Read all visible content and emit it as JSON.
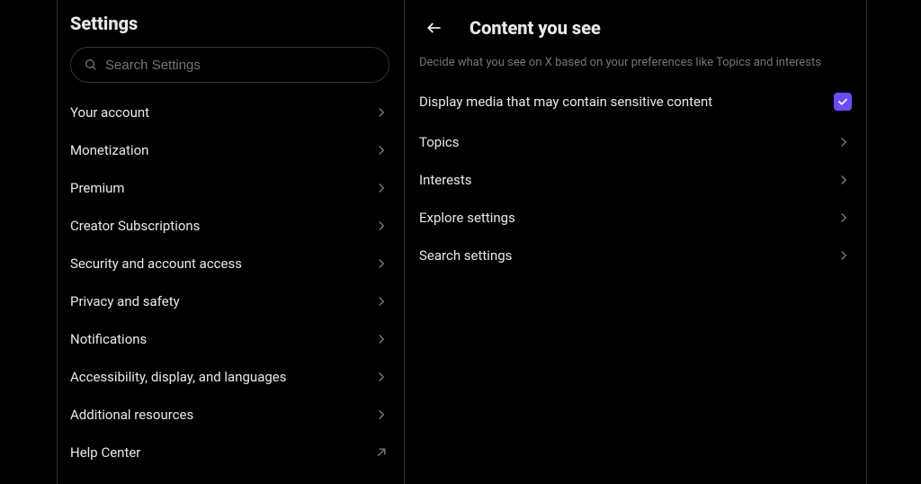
{
  "settings": {
    "title": "Settings",
    "search_placeholder": "Search Settings",
    "items": [
      {
        "label": "Your account",
        "external": false
      },
      {
        "label": "Monetization",
        "external": false
      },
      {
        "label": "Premium",
        "external": false
      },
      {
        "label": "Creator Subscriptions",
        "external": false
      },
      {
        "label": "Security and account access",
        "external": false
      },
      {
        "label": "Privacy and safety",
        "external": false
      },
      {
        "label": "Notifications",
        "external": false
      },
      {
        "label": "Accessibility, display, and languages",
        "external": false
      },
      {
        "label": "Additional resources",
        "external": false
      },
      {
        "label": "Help Center",
        "external": true
      }
    ]
  },
  "content": {
    "title": "Content you see",
    "subtitle": "Decide what you see on X based on your preferences like Topics and interests",
    "toggle": {
      "label": "Display media that may contain sensitive content",
      "checked": true
    },
    "items": [
      {
        "label": "Topics"
      },
      {
        "label": "Interests"
      },
      {
        "label": "Explore settings"
      },
      {
        "label": "Search settings"
      }
    ]
  },
  "colors": {
    "accent": "#6d4aff",
    "muted": "#71767b",
    "border": "#2f3336"
  }
}
